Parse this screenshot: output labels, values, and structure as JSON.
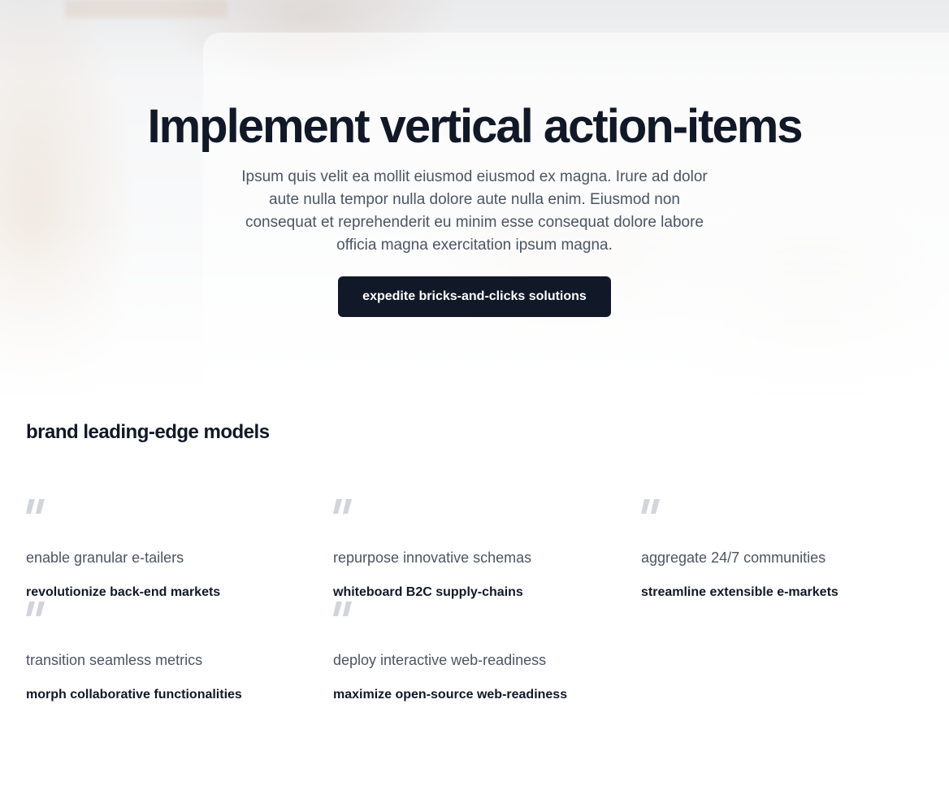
{
  "hero": {
    "title": "Implement vertical action-items",
    "description": "Ipsum quis velit ea mollit eiusmod eiusmod ex magna. Irure ad dolor aute nulla tempor nulla dolore aute nulla enim. Eiusmod non consequat et reprehenderit eu minim esse consequat dolore labore officia magna exercitation ipsum magna.",
    "cta_label": "expedite bricks-and-clicks solutions"
  },
  "testimonials": {
    "title": "brand leading-edge models",
    "items": [
      {
        "quote": "enable granular e-tailers",
        "author": "revolutionize back-end markets",
        "icon": "quote-icon"
      },
      {
        "quote": "repurpose innovative schemas",
        "author": "whiteboard B2C supply-chains",
        "icon": "quote-icon"
      },
      {
        "quote": "aggregate 24/7 communities",
        "author": "streamline extensible e-markets",
        "icon": "quote-icon"
      },
      {
        "quote": "transition seamless metrics",
        "author": "morph collaborative functionalities",
        "icon": "quote-icon"
      },
      {
        "quote": "deploy interactive web-readiness",
        "author": "maximize open-source web-readiness",
        "icon": "quote-icon"
      }
    ]
  },
  "colors": {
    "heading": "#111827",
    "body_text": "#4b5563",
    "button_bg": "#111827",
    "button_text": "#ffffff",
    "quote_icon": "#d1d5db"
  }
}
